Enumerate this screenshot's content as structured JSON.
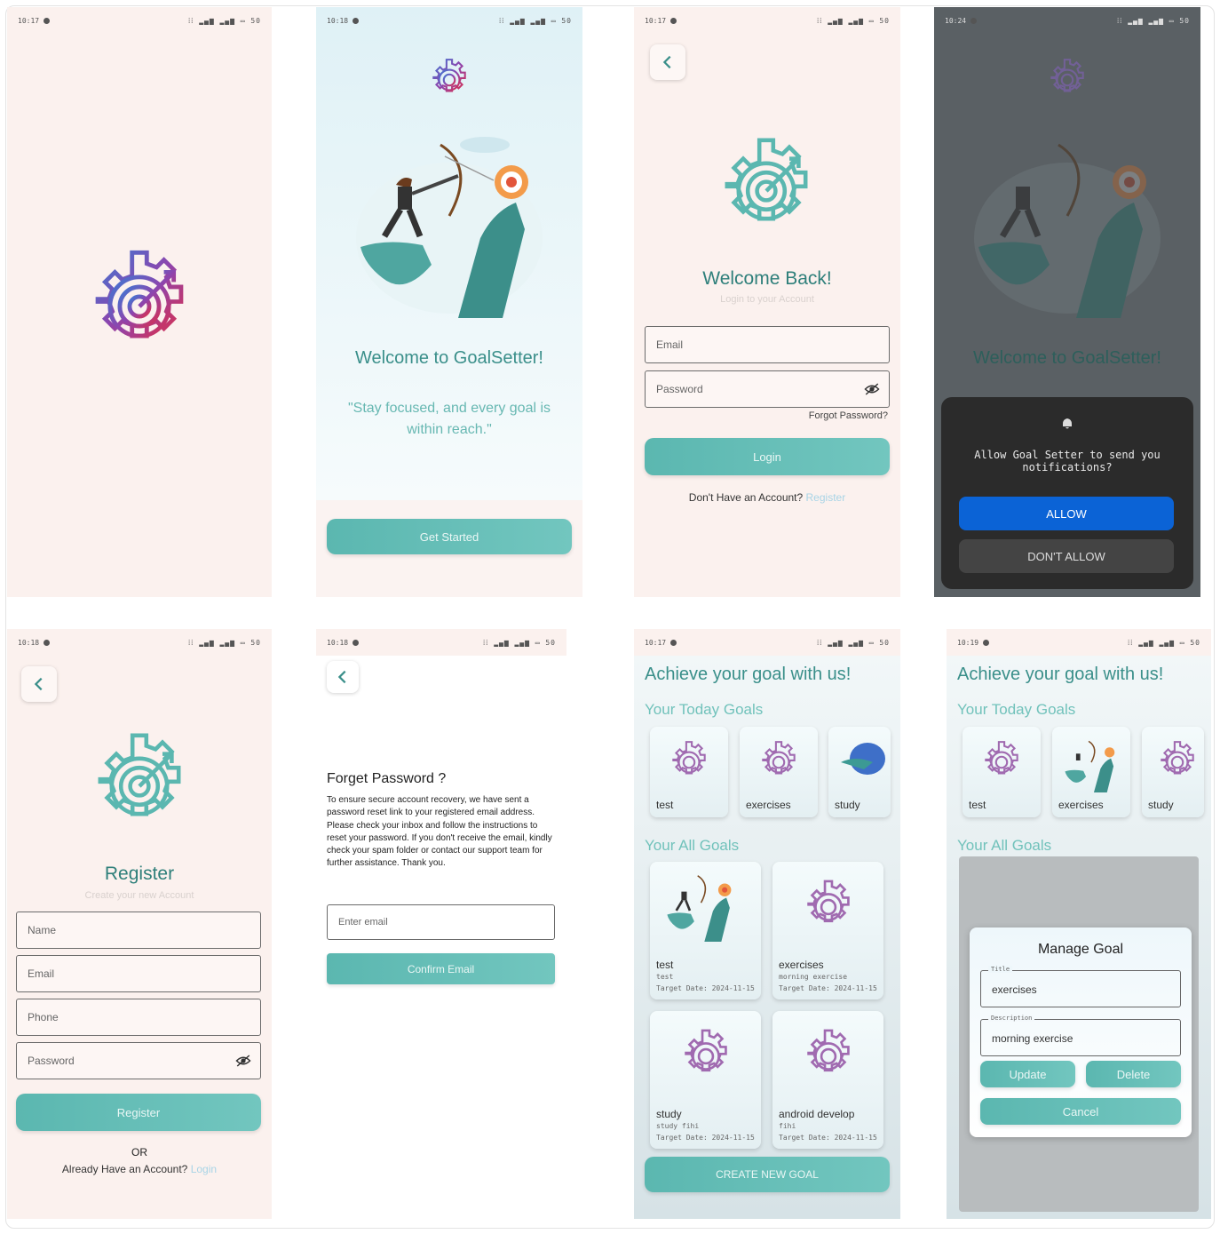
{
  "colors": {
    "teal": "#5bb7b0",
    "teal_dark": "#3a8f8a",
    "peach_bg": "#fbf1ee",
    "blue_button": "#0b63d6"
  },
  "screens": {
    "splash": {
      "time": "10:17",
      "status_icons": "⁞⁞ ▂▄▆ ▂▄▆ ▭ 50"
    },
    "welcome": {
      "time": "10:18",
      "status_icons": "⁞⁞ ▂▄▆ ▂▄▆ ▭ 50",
      "title": "Welcome to GoalSetter!",
      "quote": "\"Stay focused, and every goal is within reach.\"",
      "cta": "Get Started"
    },
    "login": {
      "time": "10:17",
      "status_icons": "⁞⁞ ▂▄▆ ▂▄▆ ▭ 50",
      "title": "Welcome Back!",
      "subtitle": "Login to your Account",
      "email_placeholder": "Email",
      "password_placeholder": "Password",
      "forgot": "Forgot Password?",
      "login_button": "Login",
      "no_account": "Don't Have an Account?",
      "register_link": "Register"
    },
    "permission": {
      "time": "10:24",
      "status_icons": "⁞⁞ ▂▄▆ ▂▄▆ ▭ 50",
      "title": "Welcome to GoalSetter!",
      "message": "Allow Goal Setter to send you notifications?",
      "allow": "ALLOW",
      "deny": "DON'T ALLOW"
    },
    "register": {
      "time": "10:18",
      "status_icons": "⁞⁞ ▂▄▆ ▂▄▆ ▭ 50",
      "title": "Register",
      "subtitle": "Create your new Account",
      "name_placeholder": "Name",
      "email_placeholder": "Email",
      "phone_placeholder": "Phone",
      "password_placeholder": "Password",
      "register_button": "Register",
      "or": "OR",
      "have_account": "Already Have an Account?",
      "login_link": "Login"
    },
    "forgot": {
      "time": "10:18",
      "status_icons": "⁞⁞ ▂▄▆ ▂▄▆ ▭ 50",
      "title": "Forget Password ?",
      "body": "To ensure secure account recovery, we have sent a password reset link to your registered email address. Please check your inbox and follow the instructions to reset your password. If you don't receive the email, kindly check your spam folder or contact our support team for further assistance. Thank you.",
      "email_placeholder": "Enter email",
      "confirm_button": "Confirm Email"
    },
    "home": {
      "time": "10:17",
      "status_icons": "⁞⁞ ▂▄▆ ▂▄▆ ▭ 50",
      "headline": "Achieve your goal with us!",
      "today_heading": "Your Today Goals",
      "today_goals": [
        "test",
        "exercises",
        "study"
      ],
      "all_heading": "Your All Goals",
      "all_goals": [
        {
          "title": "test",
          "desc": "test",
          "date": "Target Date: 2024-11-15"
        },
        {
          "title": "exercises",
          "desc": "morning exercise",
          "date": "Target Date: 2024-11-15"
        },
        {
          "title": "study",
          "desc": "study fihi",
          "date": "Target Date: 2024-11-15"
        },
        {
          "title": "android develop",
          "desc": "fihi",
          "date": "Target Date: 2024-11-15"
        }
      ],
      "create_button": "CREATE NEW GOAL"
    },
    "manage": {
      "time": "10:19",
      "status_icons": "⁞⁞ ▂▄▆ ▂▄▆ ▭ 50",
      "headline": "Achieve your goal with us!",
      "today_heading": "Your Today Goals",
      "today_goals": [
        "test",
        "exercises",
        "study"
      ],
      "all_heading": "Your All Goals",
      "dialog_title": "Manage Goal",
      "title_label": "Title",
      "title_value": "exercises",
      "description_label": "Description",
      "description_value": "morning exercise",
      "update": "Update",
      "delete": "Delete",
      "cancel": "Cancel"
    }
  }
}
